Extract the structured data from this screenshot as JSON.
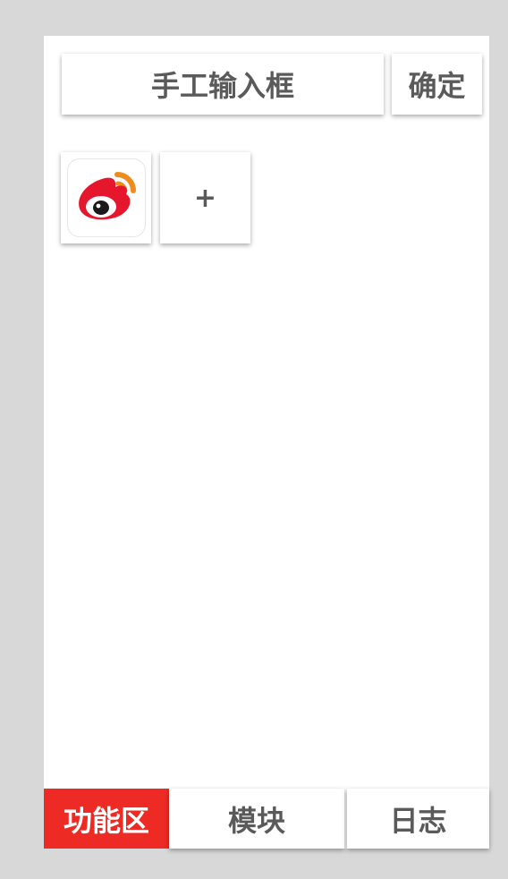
{
  "input": {
    "placeholder": "手工输入框"
  },
  "confirm_label": "确定",
  "tiles": [
    {
      "icon": "weibo-icon"
    },
    {
      "label": "+"
    }
  ],
  "tabs": [
    {
      "label": "功能区",
      "active": true
    },
    {
      "label": "模块",
      "active": false
    },
    {
      "label": "日志",
      "active": false
    }
  ],
  "colors": {
    "accent": "#ee2a24",
    "text": "#5a5a5a",
    "background": "#d8d8d8"
  }
}
